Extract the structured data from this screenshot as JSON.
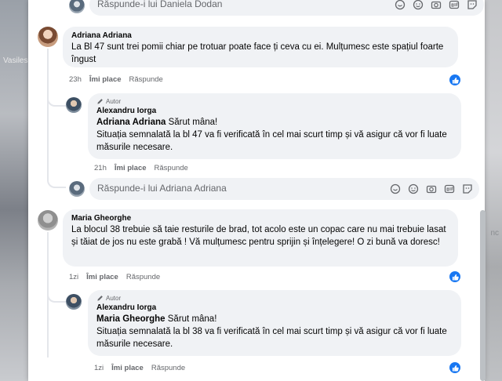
{
  "background": {
    "left_text": "Vasiles",
    "right_text": "nc"
  },
  "top_reply": {
    "placeholder": "Răspunde-i lui Daniela Dodan"
  },
  "comments": [
    {
      "author": "Adriana Adriana",
      "text": "La Bl 47 sunt trei pomii chiar pe trotuar poate face ți ceva cu ei. Mulțumesc este spațiul foarte îngust",
      "time": "23h",
      "like_label": "Îmi place",
      "reply_label": "Răspunde",
      "reply": {
        "tag": "Autor",
        "author": "Alexandru Iorga",
        "mention": "Adriana Adriana",
        "greeting": " Sărut mâna!",
        "text": "Situația semnalată la bl 47 va fi verificată în cel mai scurt timp și vă asigur că vor fi luate măsurile necesare.",
        "time": "21h",
        "like_label": "Îmi place",
        "reply_label": "Răspunde"
      },
      "reply_box_placeholder": "Răspunde-i lui Adriana Adriana"
    },
    {
      "author": "Maria Gheorghe",
      "text": "La blocul 38 trebuie să taie resturile de brad, tot acolo este un copac care nu mai trebuie lasat și tăiat de jos nu este grabă ! Vă mulțumesc pentru sprijin și înțelegere! O zi bună va doresc!",
      "time": "1zi",
      "like_label": "Îmi place",
      "reply_label": "Răspunde",
      "reply": {
        "tag": "Autor",
        "author": "Alexandru Iorga",
        "mention": "Maria Gheorghe",
        "greeting": " Sărut mâna!",
        "text": "Situația semnalată la bl 38 va fi verificată în cel mai scurt timp și vă asigur că vor fi luate măsurile necesare.",
        "time": "1zi",
        "like_label": "Îmi place",
        "reply_label": "Răspunde"
      }
    }
  ],
  "colors": {
    "like_blue": "#1877f2",
    "bubble": "#f0f2f5",
    "meta_gray": "#65676b"
  }
}
